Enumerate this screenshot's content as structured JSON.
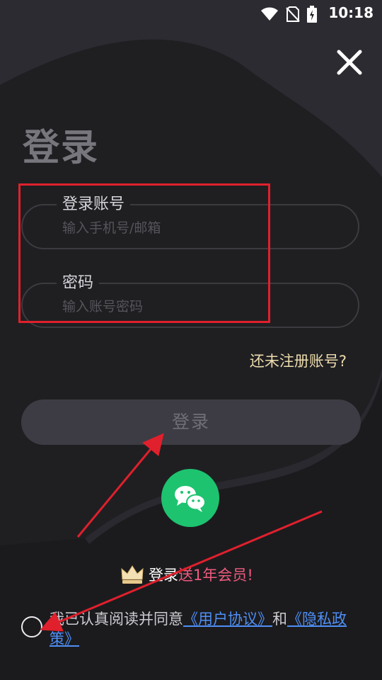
{
  "status_bar": {
    "time": "10:18"
  },
  "page": {
    "title": "登录"
  },
  "account_field": {
    "label": "登录账号",
    "placeholder": "输入手机号/邮箱"
  },
  "password_field": {
    "label": "密码",
    "placeholder": "输入账号密码"
  },
  "register_link": "还未注册账号?",
  "login_button": "登录",
  "promo": {
    "prefix": "登录",
    "highlight": "送1年会员!"
  },
  "agreement": {
    "prefix": "我已认真阅读并同意",
    "user_agreement": "《用户协议》",
    "connector": "和",
    "privacy_policy": "《隐私政策》"
  },
  "colors": {
    "background": "#1f1f22",
    "annotation_red": "#e0202c",
    "wechat_green": "#1ec36f",
    "register_gold": "#eddcad",
    "promo_pink": "#ef5a7c",
    "link_blue": "#4f8ff5"
  },
  "icons": [
    "wifi-icon",
    "no-sim-icon",
    "battery-charging-icon",
    "close-icon",
    "wechat-icon",
    "crown-icon"
  ]
}
